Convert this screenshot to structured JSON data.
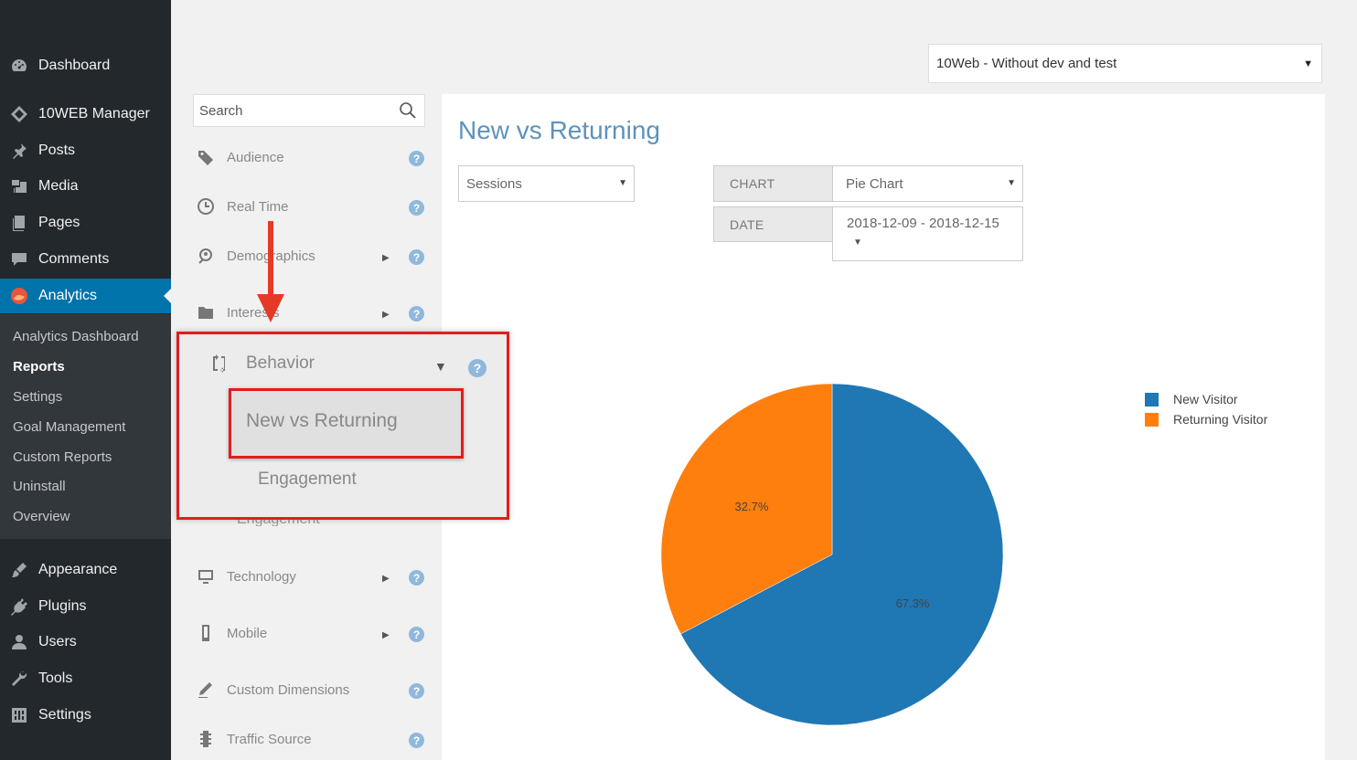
{
  "sidebar": {
    "items": [
      {
        "label": "Dashboard",
        "icon": "dashboard-icon"
      },
      {
        "label": "10WEB Manager",
        "icon": "diamond-icon"
      },
      {
        "label": "Posts",
        "icon": "pin-icon"
      },
      {
        "label": "Media",
        "icon": "media-icon"
      },
      {
        "label": "Pages",
        "icon": "pages-icon"
      },
      {
        "label": "Comments",
        "icon": "comment-icon"
      },
      {
        "label": "Analytics",
        "icon": "analytics-icon"
      },
      {
        "label": "Appearance",
        "icon": "brush-icon"
      },
      {
        "label": "Plugins",
        "icon": "plug-icon"
      },
      {
        "label": "Users",
        "icon": "user-icon"
      },
      {
        "label": "Tools",
        "icon": "wrench-icon"
      },
      {
        "label": "Settings",
        "icon": "settings-icon"
      }
    ],
    "submenu": [
      "Analytics Dashboard",
      "Reports",
      "Settings",
      "Goal Management",
      "Custom Reports",
      "Uninstall",
      "Overview"
    ],
    "active_color": "#0073aa"
  },
  "account_select": {
    "value": "10Web - Without dev and test"
  },
  "report_menu": {
    "search_placeholder": "Search",
    "items": [
      {
        "label": "Audience",
        "icon": "tag-icon"
      },
      {
        "label": "Real Time",
        "icon": "clock-icon"
      },
      {
        "label": "Demographics",
        "icon": "demographics-icon"
      },
      {
        "label": "Interests",
        "icon": "folder-icon"
      },
      {
        "label": "Technology",
        "icon": "monitor-icon"
      },
      {
        "label": "Mobile",
        "icon": "mobile-icon"
      },
      {
        "label": "Custom Dimensions",
        "icon": "pencil-icon"
      },
      {
        "label": "Traffic Source",
        "icon": "traffic-light-icon"
      }
    ],
    "behavior": {
      "label": "Behavior",
      "subitems": [
        "New vs Returning",
        "Engagement"
      ]
    },
    "hidden_engagement": "Engagement"
  },
  "report": {
    "title": "New vs Returning",
    "metric": "Sessions",
    "chart_label": "CHART",
    "chart_type": "Pie Chart",
    "date_label": "DATE",
    "date_range": "2018-12-09 - 2018-12-15"
  },
  "chart_data": {
    "type": "pie",
    "categories": [
      "New Visitor",
      "Returning Visitor"
    ],
    "values": [
      67.3,
      32.7
    ],
    "labels": [
      "67.3%",
      "32.7%"
    ],
    "colors": [
      "#1f77b4",
      "#ff7f0e"
    ],
    "legend": "top-right"
  },
  "highlight_color": "#e21d1d"
}
